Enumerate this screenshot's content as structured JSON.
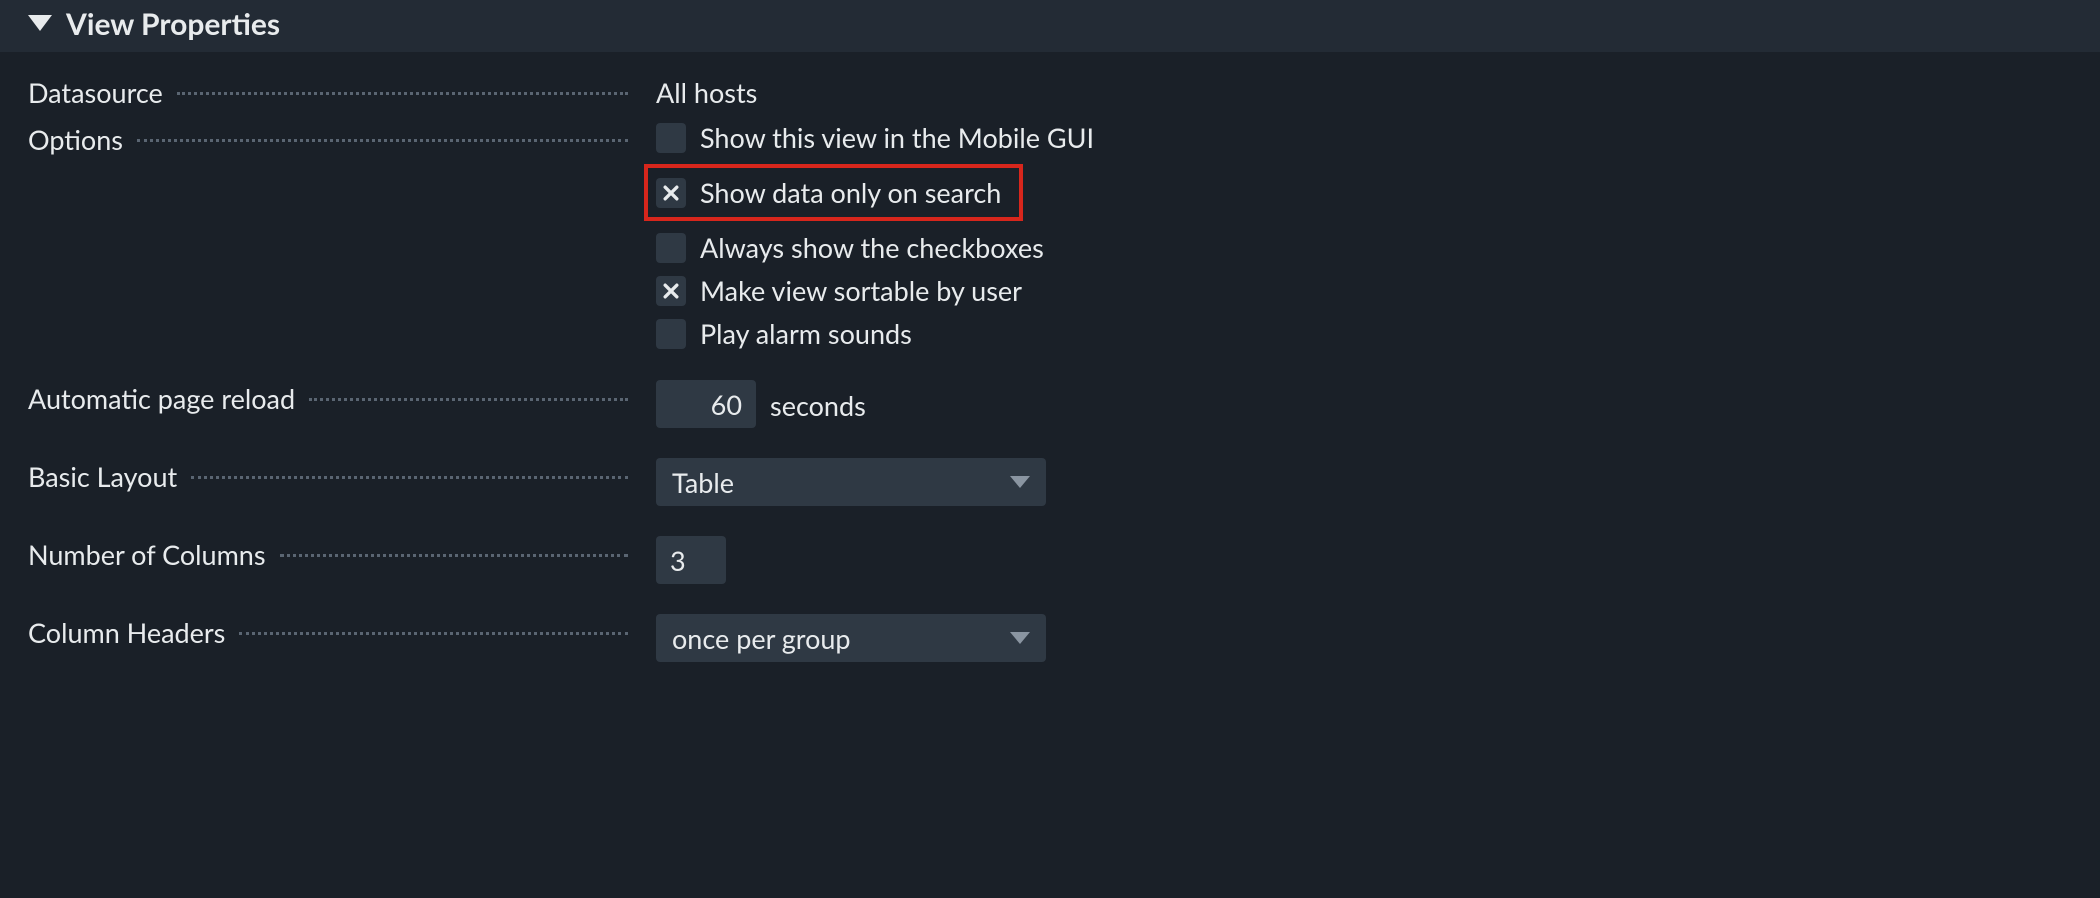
{
  "section_title": "View Properties",
  "datasource": {
    "label": "Datasource",
    "value": "All hosts"
  },
  "options": {
    "label": "Options",
    "items": [
      {
        "label": "Show this view in the Mobile GUI",
        "checked": false,
        "highlight": false
      },
      {
        "label": "Show data only on search",
        "checked": true,
        "highlight": true
      },
      {
        "label": "Always show the checkboxes",
        "checked": false,
        "highlight": false
      },
      {
        "label": "Make view sortable by user",
        "checked": true,
        "highlight": false
      },
      {
        "label": "Play alarm sounds",
        "checked": false,
        "highlight": false
      }
    ]
  },
  "reload": {
    "label": "Automatic page reload",
    "value": "60",
    "unit": "seconds"
  },
  "layout": {
    "label": "Basic Layout",
    "value": "Table"
  },
  "columns": {
    "label": "Number of Columns",
    "value": "3"
  },
  "headers": {
    "label": "Column Headers",
    "value": "once per group"
  }
}
